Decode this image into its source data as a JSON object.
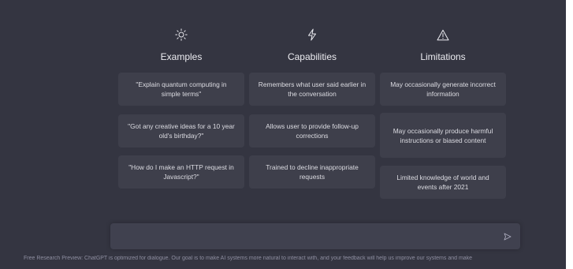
{
  "columns": [
    {
      "icon": "sun-icon",
      "title": "Examples",
      "cards": [
        "\"Explain quantum computing in simple terms\"",
        "\"Got any creative ideas for a 10 year old's birthday?\"",
        "\"How do I make an HTTP request in Javascript?\""
      ]
    },
    {
      "icon": "lightning-icon",
      "title": "Capabilities",
      "cards": [
        "Remembers what user said earlier in the conversation",
        "Allows user to provide follow-up corrections",
        "Trained to decline inappropriate requests"
      ]
    },
    {
      "icon": "warning-icon",
      "title": "Limitations",
      "cards": [
        "May occasionally generate incorrect information",
        "May occasionally produce harmful instructions or biased content",
        "Limited knowledge of world and events after 2021"
      ]
    }
  ],
  "input": {
    "placeholder": "",
    "send_icon": "send-icon"
  },
  "footer": "Free Research Preview: ChatGPT is optimized for dialogue. Our goal is to make AI systems more natural to interact with, and your feedback will help us improve our systems and make"
}
